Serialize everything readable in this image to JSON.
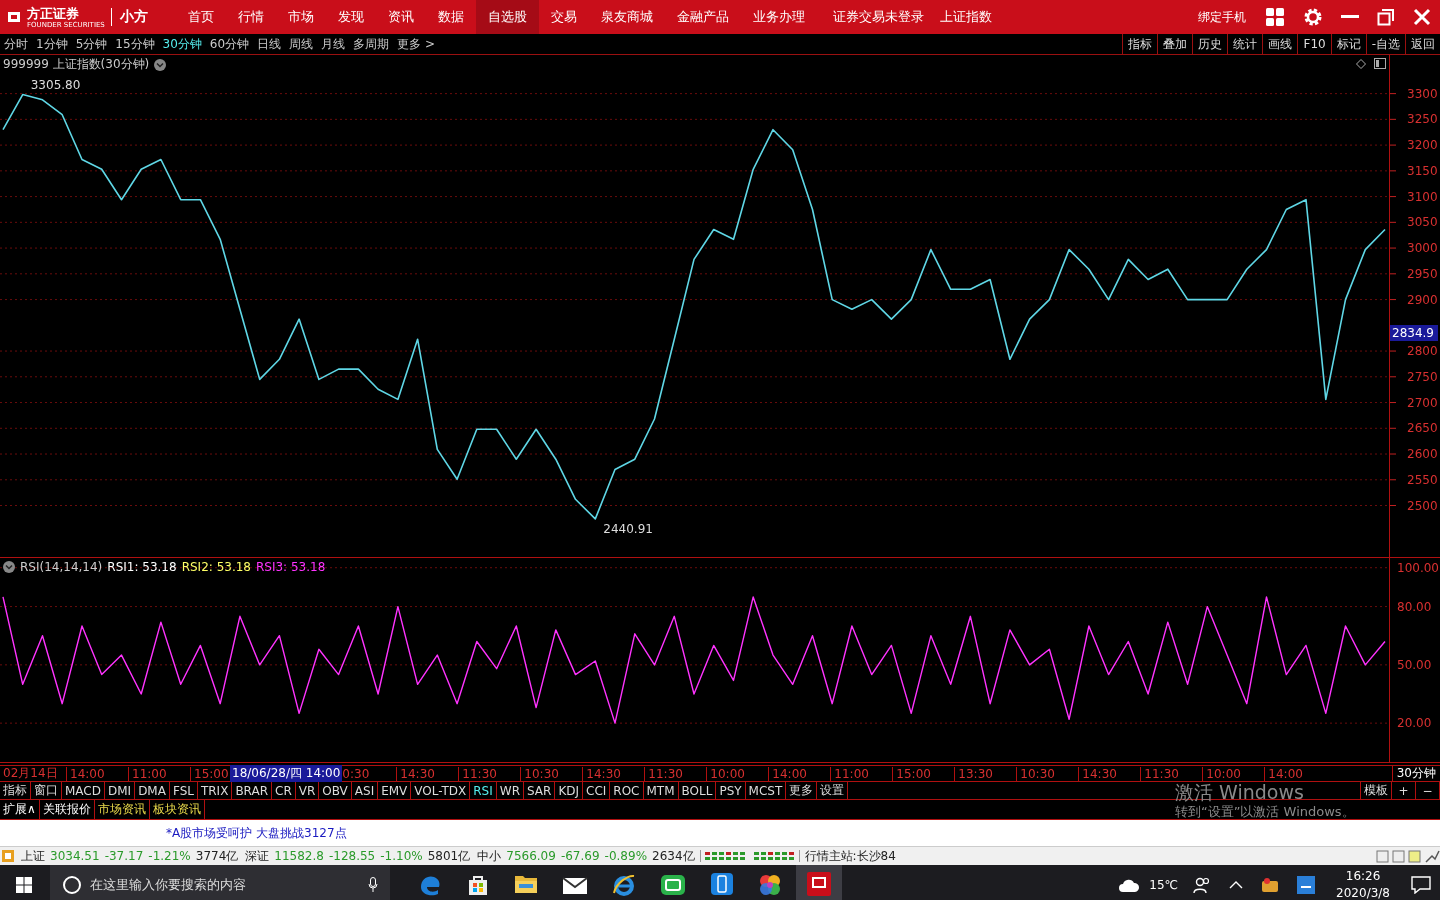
{
  "title_bar": {
    "logo": "方正证券",
    "logo_sub": "FOUNDER SECURITIES",
    "product": "小方",
    "nav": [
      {
        "label": "首页",
        "selected": false
      },
      {
        "label": "行情",
        "selected": false
      },
      {
        "label": "市场",
        "selected": false
      },
      {
        "label": "发现",
        "selected": false
      },
      {
        "label": "资讯",
        "selected": false
      },
      {
        "label": "数据",
        "selected": false
      },
      {
        "label": "自选股",
        "selected": true
      },
      {
        "label": "交易",
        "selected": false
      },
      {
        "label": "泉友商城",
        "selected": false
      },
      {
        "label": "金融产品",
        "selected": false
      },
      {
        "label": "业务办理",
        "selected": false
      }
    ],
    "login_status": "证券交易未登录",
    "index_name": "上证指数",
    "bind_phone": "绑定手机"
  },
  "period_bar": {
    "periods": [
      {
        "label": "分时",
        "selected": false
      },
      {
        "label": "1分钟",
        "selected": false
      },
      {
        "label": "5分钟",
        "selected": false
      },
      {
        "label": "15分钟",
        "selected": false
      },
      {
        "label": "30分钟",
        "selected": true
      },
      {
        "label": "60分钟",
        "selected": false
      },
      {
        "label": "日线",
        "selected": false
      },
      {
        "label": "周线",
        "selected": false
      },
      {
        "label": "月线",
        "selected": false
      },
      {
        "label": "多周期",
        "selected": false
      },
      {
        "label": "更多 >",
        "selected": false
      }
    ],
    "tools": [
      "指标",
      "叠加",
      "历史",
      "统计",
      "画线",
      "F10",
      "标记",
      "-自选",
      "返回"
    ]
  },
  "price_chart": {
    "title": "999999 上证指数(30分钟)",
    "current_price": "2834.9",
    "chart_data": {
      "type": "line",
      "grid": true,
      "ylim": [
        2400,
        3375
      ],
      "yticks": [
        2500,
        2550,
        2600,
        2650,
        2700,
        2750,
        2800,
        2900,
        2950,
        3000,
        3050,
        3100,
        3150,
        3200,
        3250,
        3300
      ],
      "series": [
        {
          "color": "#5fd7e6",
          "values": [
            3230,
            3298,
            3288,
            3259,
            3172,
            3153,
            3094,
            3153,
            3172,
            3094,
            3094,
            3017,
            2881,
            2745,
            2784,
            2862,
            2745,
            2765,
            2765,
            2726,
            2706,
            2823,
            2609,
            2551,
            2648,
            2648,
            2590,
            2648,
            2590,
            2512,
            2474,
            2570,
            2590,
            2668,
            2823,
            2978,
            3036,
            3017,
            3153,
            3230,
            3191,
            3075,
            2900,
            2881,
            2900,
            2862,
            2900,
            2997,
            2920,
            2920,
            2939,
            2784,
            2862,
            2900,
            2997,
            2959,
            2900,
            2978,
            2939,
            2959,
            2900,
            2900,
            2900,
            2959,
            2997,
            3075,
            3094,
            2706,
            2900,
            2997,
            3036
          ]
        }
      ],
      "annotations": [
        {
          "text": "3305.80"
        },
        {
          "text": "2440.91"
        }
      ]
    }
  },
  "rsi_chart": {
    "title": "RSI(14,14,14)",
    "readings": [
      {
        "label": "RSI1: 53.18",
        "color": "#ffffff"
      },
      {
        "label": "RSI2: 53.18",
        "color": "#ffff66"
      },
      {
        "label": "RSI3: 53.18",
        "color": "#ff33ff"
      }
    ],
    "chart_data": {
      "type": "line",
      "grid": true,
      "ylim": [
        0,
        105
      ],
      "yticks": [
        {
          "value": 20,
          "label": "20.00"
        },
        {
          "value": 50,
          "label": "50.00"
        },
        {
          "value": 80,
          "label": "80.00"
        },
        {
          "value": 100,
          "label": "100.00"
        }
      ],
      "series": [
        {
          "color": "#ff33ff",
          "values": [
            85,
            40,
            65,
            30,
            70,
            45,
            55,
            35,
            72,
            40,
            60,
            30,
            75,
            50,
            65,
            25,
            58,
            45,
            70,
            35,
            80,
            40,
            55,
            30,
            62,
            48,
            70,
            28,
            68,
            45,
            52,
            20,
            66,
            50,
            75,
            35,
            60,
            42,
            85,
            55,
            40,
            65,
            30,
            70,
            45,
            60,
            25,
            65,
            40,
            75,
            30,
            68,
            50,
            58,
            22,
            70,
            45,
            62,
            35,
            72,
            40,
            80,
            55,
            30,
            85,
            45,
            60,
            25,
            70,
            50,
            62
          ]
        }
      ]
    }
  },
  "time_axis": {
    "labels": [
      "02月14日",
      "14:00",
      "11:00",
      "15:00"
    ],
    "cursor_label": "18/06/28/四 14:00",
    "labels_after": [
      "0:30",
      "14:30",
      "11:30",
      "10:30",
      "14:30",
      "11:30",
      "10:00",
      "14:00",
      "11:00",
      "15:00",
      "13:30",
      "10:30",
      "14:30",
      "11:30",
      "10:00",
      "14:00"
    ],
    "period": "30分钟"
  },
  "indicator_tabs": [
    {
      "label": "指标",
      "selected": false
    },
    {
      "label": "窗口",
      "selected": false
    },
    {
      "label": "MACD",
      "selected": false
    },
    {
      "label": "DMI",
      "selected": false
    },
    {
      "label": "DMA",
      "selected": false
    },
    {
      "label": "FSL",
      "selected": false
    },
    {
      "label": "TRIX",
      "selected": false
    },
    {
      "label": "BRAR",
      "selected": false
    },
    {
      "label": "CR",
      "selected": false
    },
    {
      "label": "VR",
      "selected": false
    },
    {
      "label": "OBV",
      "selected": false
    },
    {
      "label": "ASI",
      "selected": false
    },
    {
      "label": "EMV",
      "selected": false
    },
    {
      "label": "VOL-TDX",
      "selected": false
    },
    {
      "label": "RSI",
      "selected": true
    },
    {
      "label": "WR",
      "selected": false
    },
    {
      "label": "SAR",
      "selected": false
    },
    {
      "label": "KDJ",
      "selected": false
    },
    {
      "label": "CCI",
      "selected": false
    },
    {
      "label": "ROC",
      "selected": false
    },
    {
      "label": "MTM",
      "selected": false
    },
    {
      "label": "BOLL",
      "selected": false
    },
    {
      "label": "PSY",
      "selected": false
    },
    {
      "label": "MCST",
      "selected": false
    },
    {
      "label": "更多",
      "selected": false
    },
    {
      "label": "设置",
      "selected": false
    }
  ],
  "template_button": "模板",
  "zoom_buttons": [
    "+",
    "−"
  ],
  "extension_tabs": [
    {
      "label": "扩展∧",
      "highlighted": false
    },
    {
      "label": "关联报价",
      "highlighted": false
    },
    {
      "label": "市场资讯",
      "highlighted": true
    },
    {
      "label": "板块资讯",
      "highlighted": true
    }
  ],
  "activation_notice": {
    "title": "激活 Windows",
    "text": "转到“设置”以激活 Windows。"
  },
  "news_ticker": "*A股市场受呵护 大盘挑战3127点",
  "status_bar": {
    "indices": [
      {
        "name": "上证",
        "value": "3034.51",
        "change": "-37.17",
        "percent": "-1.21%",
        "turnover": "3774亿",
        "color": "#2a9a2a"
      },
      {
        "name": "深证",
        "value": "11582.8",
        "change": "-128.55",
        "percent": "-1.10%",
        "turnover": "5801亿",
        "color": "#2a9a2a"
      },
      {
        "name": "中小",
        "value": "7566.09",
        "change": "-67.69",
        "percent": "-0.89%",
        "turnover": "2634亿",
        "color": "#2a9a2a"
      }
    ],
    "server": "行情主站:长沙84"
  },
  "taskbar": {
    "search_placeholder": "在这里输入你要搜索的内容",
    "temperature": "15℃",
    "time": "16:26",
    "date": "2020/3/8"
  }
}
